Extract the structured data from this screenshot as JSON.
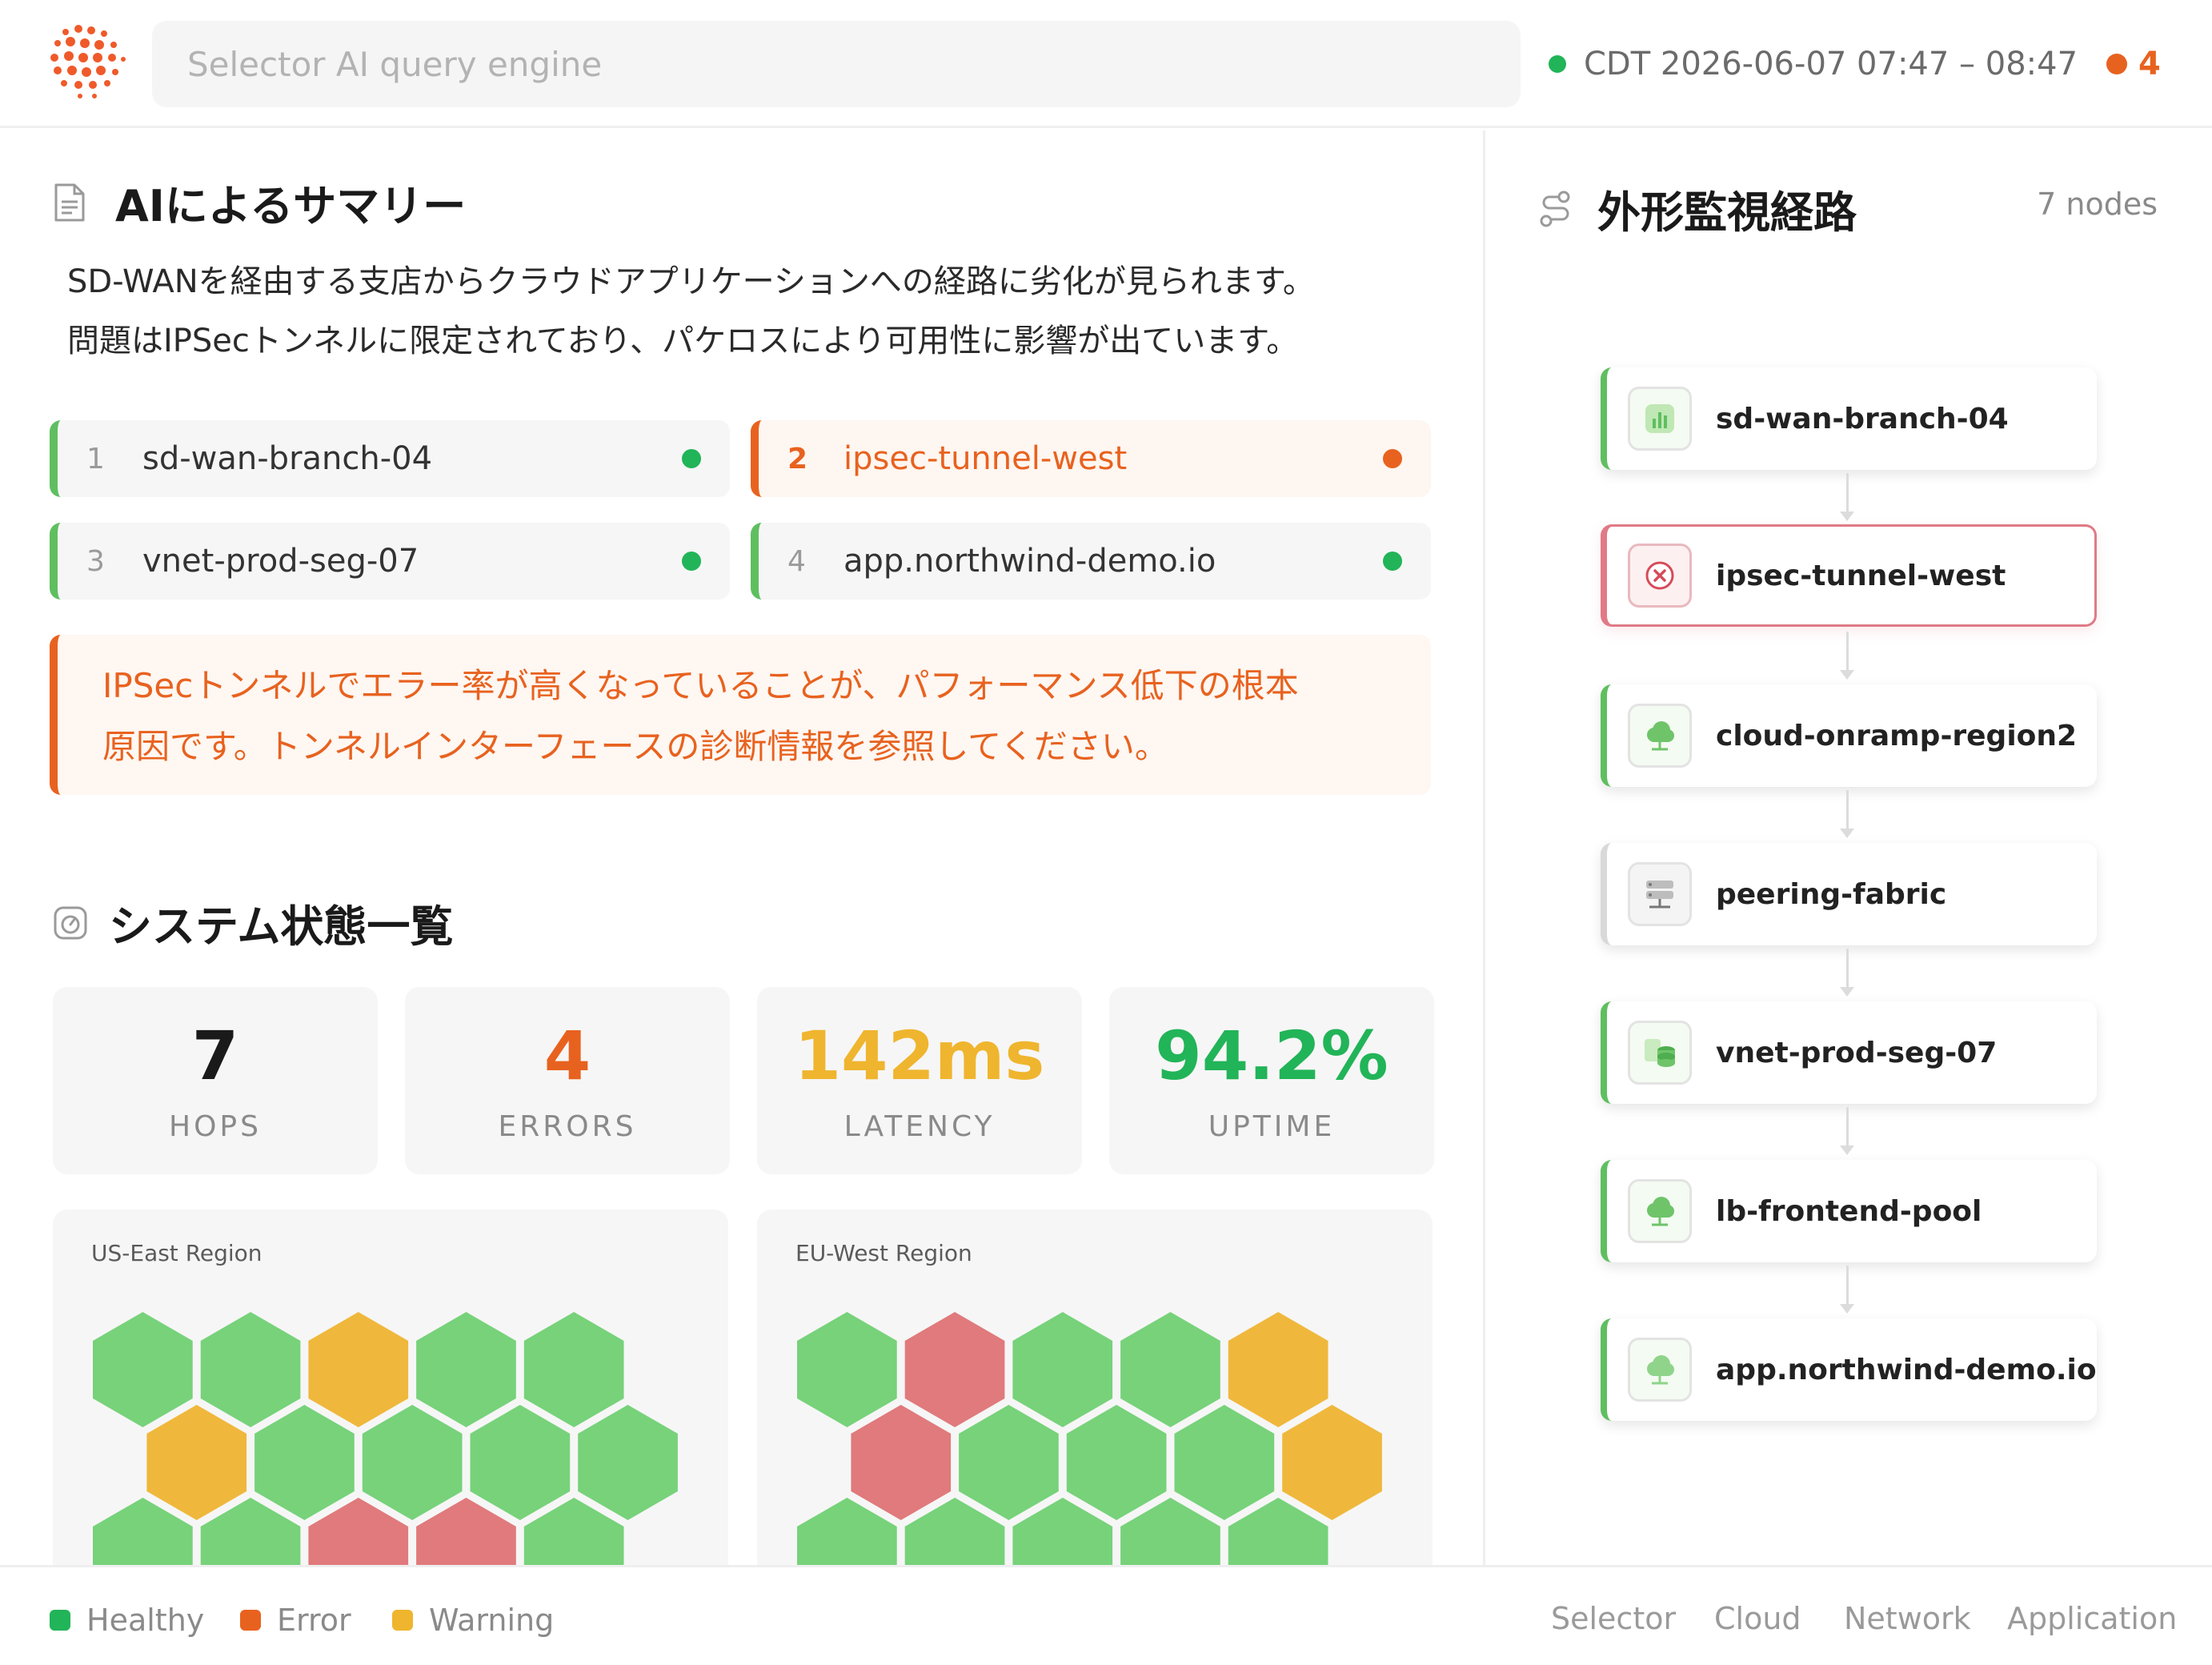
{
  "header": {
    "search_placeholder": "Selector AI query engine",
    "time_range": "CDT 2026-06-07 07:47 – 08:47",
    "alert_count": "4"
  },
  "summary": {
    "title": "AIによるサマリー",
    "text_line1": "SD-WANを経由する支店からクラウドアプリケーションへの経路に劣化が見られます。",
    "text_line2": "問題はIPSecトンネルに限定されており、パケロスにより可用性に影響が出ています。",
    "chips": [
      {
        "num": "1",
        "label": "sd-wan-branch-04",
        "status": "healthy"
      },
      {
        "num": "2",
        "label": "ipsec-tunnel-west",
        "status": "error"
      },
      {
        "num": "3",
        "label": "vnet-prod-seg-07",
        "status": "healthy"
      },
      {
        "num": "4",
        "label": "app.northwind-demo.io",
        "status": "healthy"
      }
    ],
    "callout_line1": "IPSecトンネルでエラー率が高くなっていることが、パフォーマンス低下の根本",
    "callout_line2": "原因です。トンネルインターフェースの診断情報を参照してください。"
  },
  "system": {
    "title": "システム状態一覧",
    "stats": [
      {
        "value": "7",
        "label": "HOPS",
        "color": "#1a1a1a"
      },
      {
        "value": "4",
        "label": "ERRORS",
        "color": "#e8621f"
      },
      {
        "value": "142ms",
        "label": "LATENCY",
        "color": "#efb52e"
      },
      {
        "value": "94.2%",
        "label": "UPTIME",
        "color": "#22b458"
      }
    ],
    "regions": [
      {
        "title": "US-East Region",
        "rows": [
          [
            "healthy",
            "healthy",
            "warning",
            "healthy",
            "healthy"
          ],
          [
            "warning",
            "healthy",
            "healthy",
            "healthy",
            "healthy"
          ],
          [
            "healthy",
            "healthy",
            "error",
            "error",
            "healthy"
          ]
        ]
      },
      {
        "title": "EU-West Region",
        "rows": [
          [
            "healthy",
            "error",
            "healthy",
            "healthy",
            "warning"
          ],
          [
            "error",
            "healthy",
            "healthy",
            "healthy",
            "warning"
          ],
          [
            "healthy",
            "healthy",
            "healthy",
            "healthy",
            "healthy"
          ]
        ]
      }
    ]
  },
  "path": {
    "title": "外形監視経路",
    "node_count": "7 nodes",
    "nodes": [
      {
        "label": "sd-wan-branch-04",
        "status": "healthy",
        "icon": "chart-icon"
      },
      {
        "label": "ipsec-tunnel-west",
        "status": "error",
        "icon": "error-x-icon"
      },
      {
        "label": "cloud-onramp-region2",
        "status": "healthy",
        "icon": "cloud-icon"
      },
      {
        "label": "peering-fabric",
        "status": "neutral",
        "icon": "server-icon"
      },
      {
        "label": "vnet-prod-seg-07",
        "status": "healthy",
        "icon": "database-icon"
      },
      {
        "label": "lb-frontend-pool",
        "status": "healthy",
        "icon": "cloud-icon"
      },
      {
        "label": "app.northwind-demo.io",
        "status": "healthy",
        "icon": "cloud-icon"
      }
    ]
  },
  "footer": {
    "legend": [
      {
        "label": "Healthy",
        "color": "#22b458"
      },
      {
        "label": "Error",
        "color": "#e8621f"
      },
      {
        "label": "Warning",
        "color": "#efb52e"
      }
    ],
    "links": [
      "Selector",
      "Cloud",
      "Network",
      "Application"
    ]
  },
  "colors": {
    "healthy": "#77d27a",
    "warning": "#efb83c",
    "error": "#e07a7c",
    "accent": "#e8621f"
  }
}
